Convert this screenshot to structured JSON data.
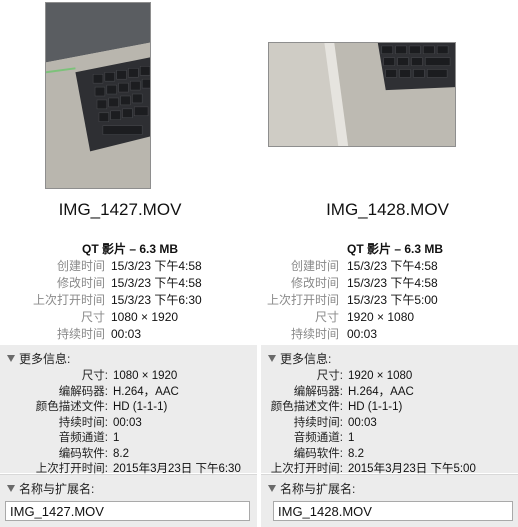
{
  "panels": [
    {
      "filename": "IMG_1427.MOV",
      "kind": "QT 影片 – 6.3 MB",
      "info": [
        {
          "label": "创建时间",
          "value": "15/3/23 下午4:58"
        },
        {
          "label": "修改时间",
          "value": "15/3/23 下午4:58"
        },
        {
          "label": "上次打开时间",
          "value": "15/3/23 下午6:30"
        },
        {
          "label": "尺寸",
          "value": "1080 × 1920"
        },
        {
          "label": "持续时间",
          "value": "00:03"
        }
      ],
      "more_info_header": "更多信息:",
      "more_info": [
        {
          "label": "尺寸:",
          "value": "1080 × 1920"
        },
        {
          "label": "编解码器:",
          "value": "H.264，AAC"
        },
        {
          "label": "颜色描述文件:",
          "value": "HD (1-1-1)"
        },
        {
          "label": "持续时间:",
          "value": "00:03"
        },
        {
          "label": "音频通道:",
          "value": "1"
        },
        {
          "label": "编码软件:",
          "value": "8.2"
        },
        {
          "label": "上次打开时间:",
          "value": "2015年3月23日 下午6:30"
        }
      ],
      "name_header": "名称与扩展名:",
      "name_value": "IMG_1427.MOV"
    },
    {
      "filename": "IMG_1428.MOV",
      "kind": "QT 影片 – 6.3 MB",
      "info": [
        {
          "label": "创建时间",
          "value": "15/3/23 下午4:58"
        },
        {
          "label": "修改时间",
          "value": "15/3/23 下午4:58"
        },
        {
          "label": "上次打开时间",
          "value": "15/3/23 下午5:00"
        },
        {
          "label": "尺寸",
          "value": "1920 × 1080"
        },
        {
          "label": "持续时间",
          "value": "00:03"
        }
      ],
      "more_info_header": "更多信息:",
      "more_info": [
        {
          "label": "尺寸:",
          "value": "1920 × 1080"
        },
        {
          "label": "编解码器:",
          "value": "H.264，AAC"
        },
        {
          "label": "颜色描述文件:",
          "value": "HD (1-1-1)"
        },
        {
          "label": "持续时间:",
          "value": "00:03"
        },
        {
          "label": "音频通道:",
          "value": "1"
        },
        {
          "label": "编码软件:",
          "value": "8.2"
        },
        {
          "label": "上次打开时间:",
          "value": "2015年3月23日 下午5:00"
        }
      ],
      "name_header": "名称与扩展名:",
      "name_value": "IMG_1428.MOV"
    }
  ],
  "colors": {
    "label_gray": "#8a8a8a",
    "section_bg": "#ececec",
    "input_border": "#a9a9a9"
  },
  "icons": {
    "disclosure": "disclosure-triangle-icon"
  }
}
